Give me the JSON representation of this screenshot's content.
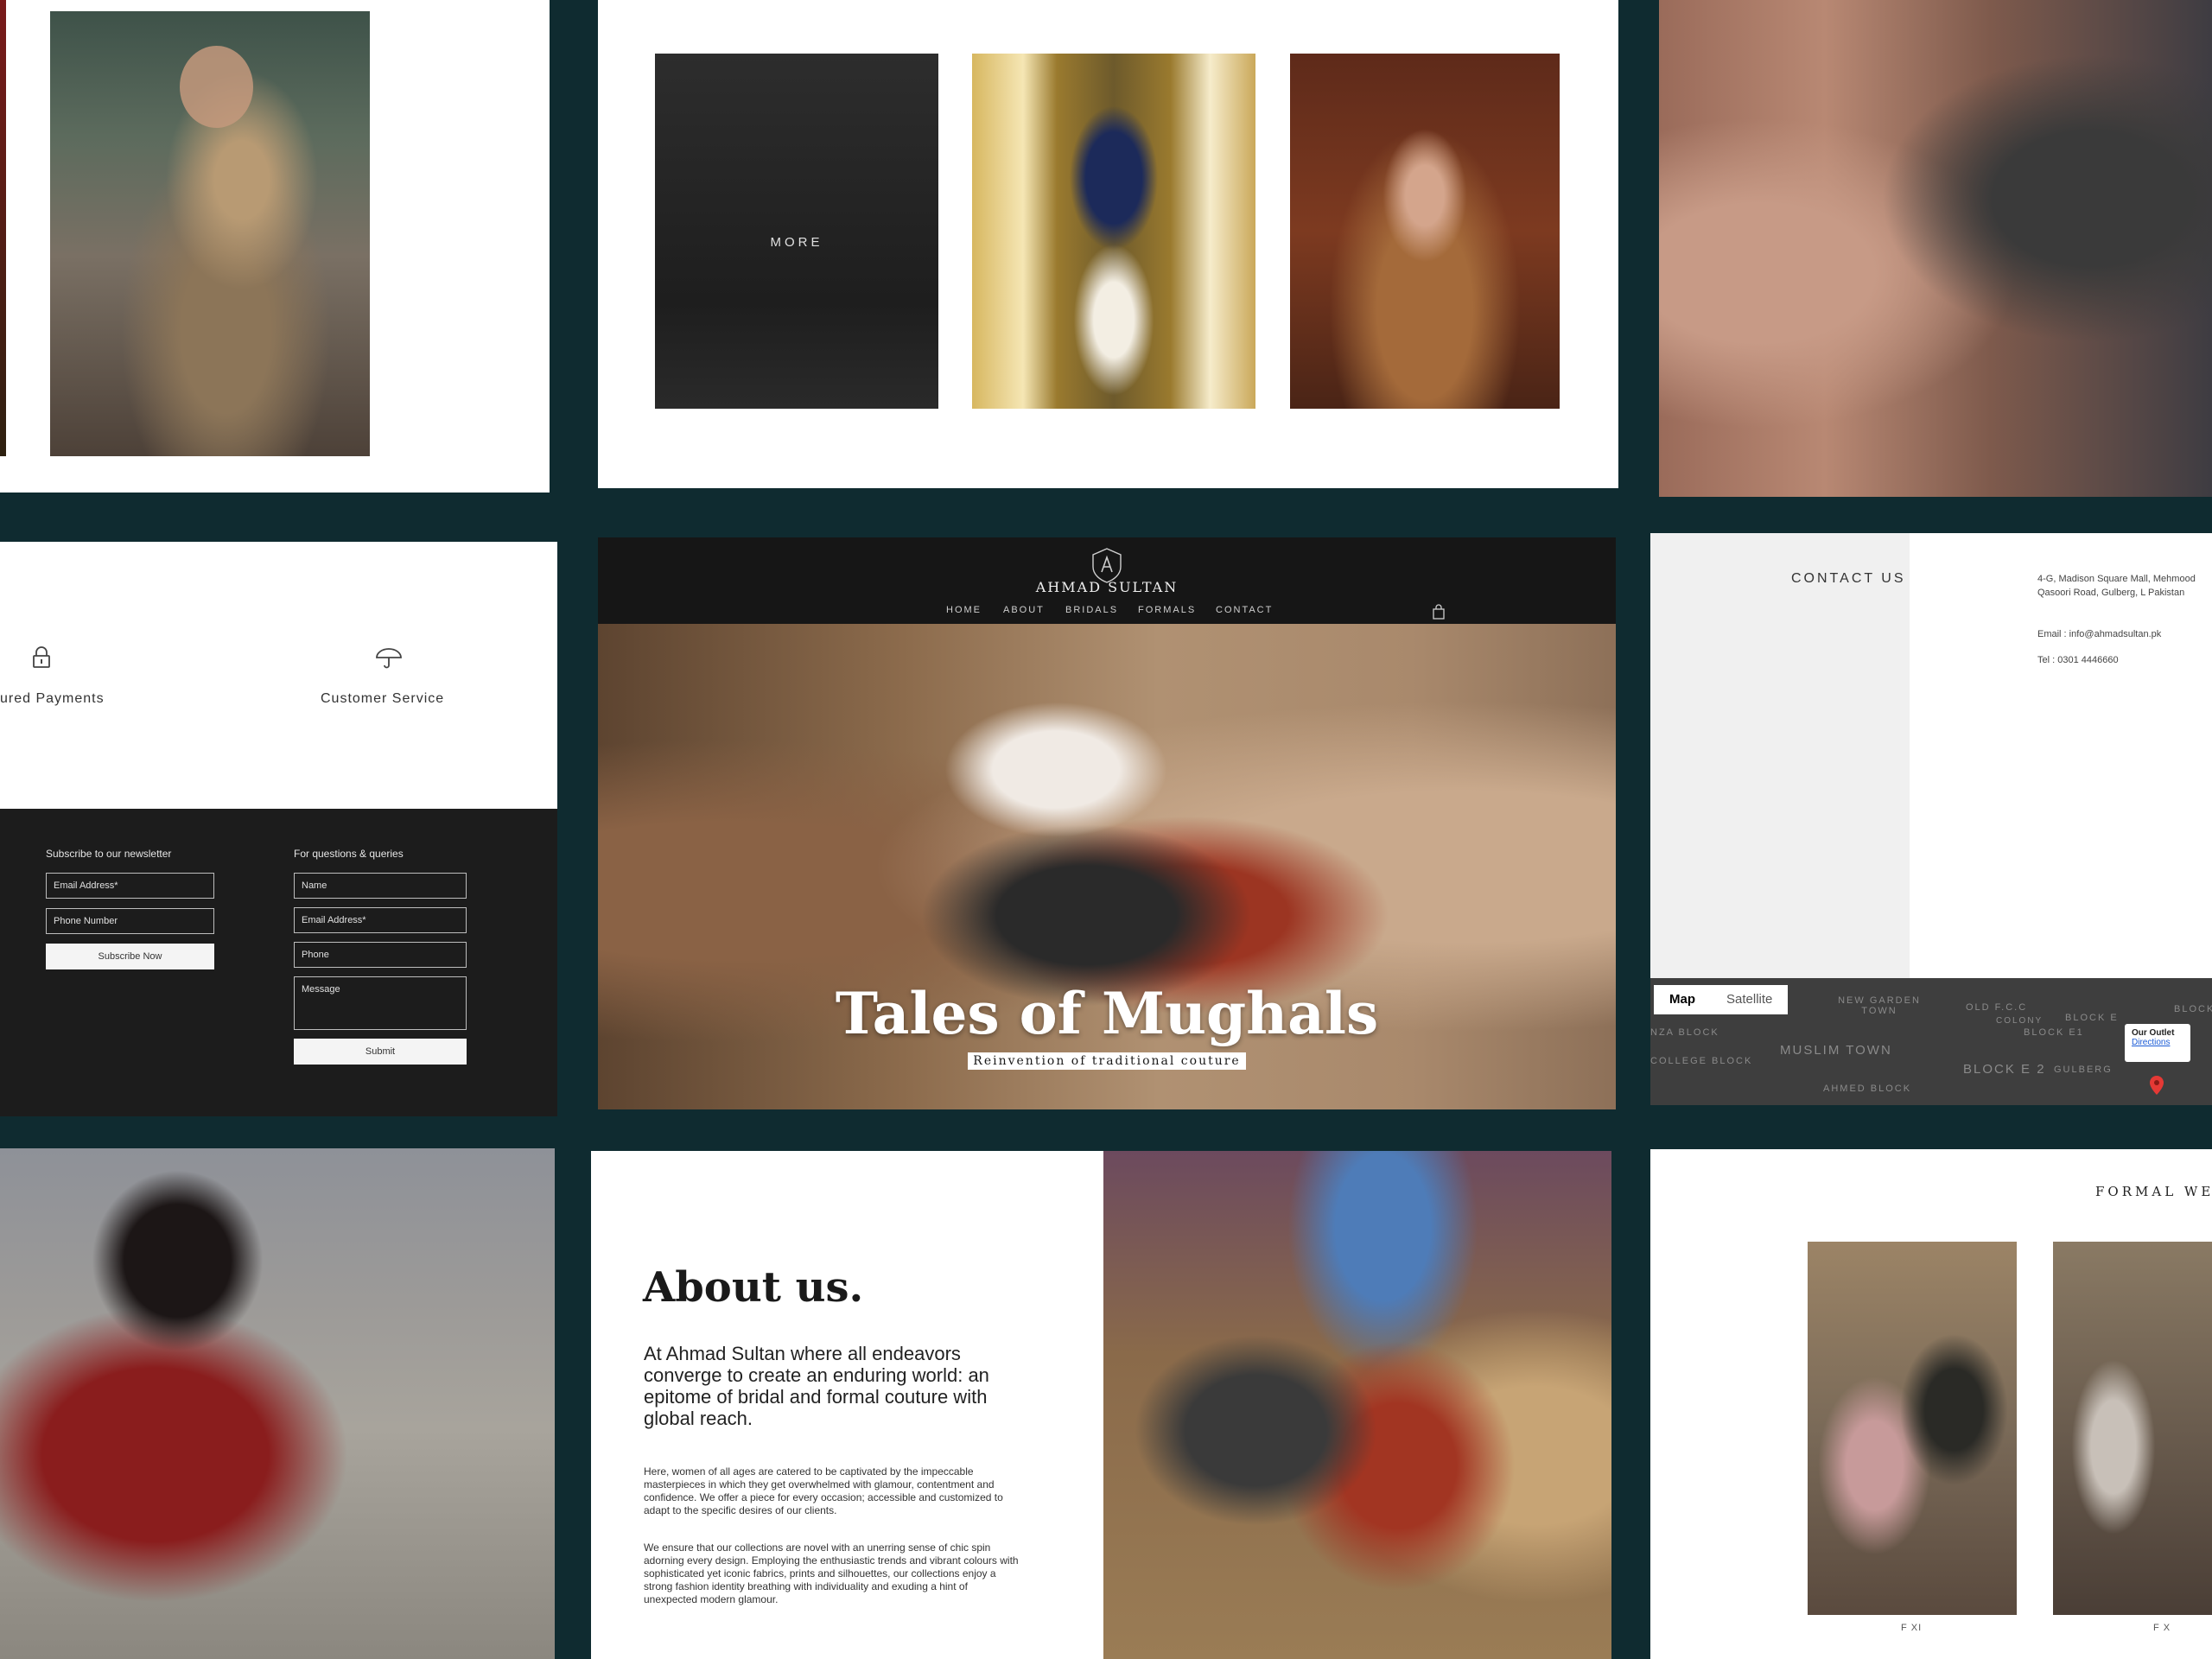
{
  "gallery": {
    "more_label": "MORE"
  },
  "features": {
    "secure_payments": "ured Payments",
    "customer_service": "Customer Service"
  },
  "footer": {
    "newsletter_heading": "Subscribe to our newsletter",
    "newsletter_email_placeholder": "Email Address*",
    "newsletter_phone_placeholder": "Phone Number",
    "subscribe_button": "Subscribe Now",
    "queries_heading": "For questions & queries",
    "name_placeholder": "Name",
    "email_placeholder": "Email Address*",
    "phone_placeholder": "Phone",
    "message_placeholder": "Message",
    "submit_button": "Submit"
  },
  "site": {
    "brand": "AHMAD SULTAN",
    "nav": [
      "HOME",
      "ABOUT",
      "BRIDALS",
      "FORMALS",
      "CONTACT"
    ],
    "hero_title": "Tales of Mughals",
    "hero_subtitle": "Reinvention of traditional couture"
  },
  "contact": {
    "title": "CONTACT US",
    "address": "4-G, Madison Square Mall, Mehmood Qasoori Road, Gulberg, L Pakistan",
    "email": "Email : info@ahmadsultan.pk",
    "tel": "Tel :     0301 4446660",
    "map_tabs": [
      "Map",
      "Satellite"
    ],
    "map_labels": [
      "NEW GARDEN TOWN",
      "OLD F.C.C",
      "BLOCK E",
      "NZA BLOCK",
      "MUSLIM TOWN",
      "COLLEGE BLOCK",
      "BLOCK E 2",
      "GULBERG",
      "BLOCK",
      "AHMED BLOCK",
      "BLOCK E1",
      "COLONY"
    ],
    "popup_title": "Our Outlet",
    "popup_link": "Directions"
  },
  "about": {
    "title": "About us.",
    "lead": "At Ahmad Sultan where all endeavors converge to create an enduring world: an epitome of bridal and formal couture with global reach.",
    "para1": "Here, women of all ages are catered to be captivated by the impeccable masterpieces in which they get overwhelmed with glamour, contentment and confidence. We offer a piece for every occasion; accessible and customized to adapt to the specific desires of our clients.",
    "para2": "We ensure that our collections are novel with an unerring sense of chic spin adorning every design. Employing the enthusiastic trends and vibrant colours with sophisticated yet iconic fabrics, prints and silhouettes, our collections enjoy a strong fashion identity breathing with individuality and exuding a hint of unexpected modern glamour."
  },
  "formal": {
    "title": "FORMAL WEAR",
    "captions": [
      "F XI",
      "F X"
    ]
  },
  "colors": {
    "background": "#0f2b30",
    "dark_panel": "#1c1c1c",
    "link_blue": "#1a5bd6",
    "pin_red": "#e53935"
  }
}
